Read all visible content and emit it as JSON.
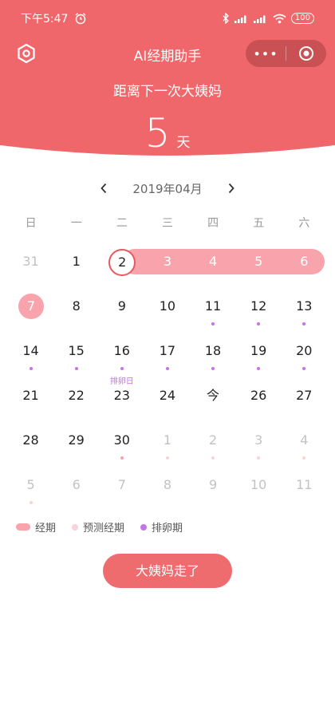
{
  "colors": {
    "header": "#f0676b",
    "accent": "#ee6b6e",
    "period": "#f9a3ad",
    "predicted": "#f8d3d7",
    "ovulation": "#c773e8"
  },
  "status_bar": {
    "time": "下午5:47",
    "alarm_icon": "alarm-icon",
    "battery": "100"
  },
  "app": {
    "title": "AI经期助手",
    "more": "•••"
  },
  "countdown": {
    "label": "距离下一次大姨妈",
    "days": "5",
    "unit": "天"
  },
  "calendar": {
    "month_label": "2019年04月",
    "prev_icon": "‹",
    "next_icon": "›",
    "weekdays": [
      "日",
      "一",
      "二",
      "三",
      "四",
      "五",
      "六"
    ],
    "weeks": [
      [
        {
          "d": "31",
          "o": true
        },
        {
          "d": "1"
        },
        {
          "d": "2",
          "sel": true
        },
        {
          "d": "3",
          "p": true
        },
        {
          "d": "4",
          "p": true
        },
        {
          "d": "5",
          "p": true
        },
        {
          "d": "6",
          "p": true
        }
      ],
      [
        {
          "d": "7",
          "tp": true
        },
        {
          "d": "8"
        },
        {
          "d": "9"
        },
        {
          "d": "10"
        },
        {
          "d": "11",
          "dot": "ov"
        },
        {
          "d": "12",
          "dot": "ov"
        },
        {
          "d": "13",
          "dot": "ov"
        }
      ],
      [
        {
          "d": "14",
          "dot": "ov"
        },
        {
          "d": "15",
          "dot": "ov"
        },
        {
          "d": "16",
          "dot": "ov",
          "tag": "排卵日"
        },
        {
          "d": "17",
          "dot": "ov"
        },
        {
          "d": "18",
          "dot": "ov"
        },
        {
          "d": "19",
          "dot": "ov"
        },
        {
          "d": "20",
          "dot": "ov"
        }
      ],
      [
        {
          "d": "21"
        },
        {
          "d": "22"
        },
        {
          "d": "23"
        },
        {
          "d": "24"
        },
        {
          "d": "今"
        },
        {
          "d": "26"
        },
        {
          "d": "27"
        }
      ],
      [
        {
          "d": "28"
        },
        {
          "d": "29"
        },
        {
          "d": "30",
          "dot": "pr"
        },
        {
          "d": "1",
          "o": true,
          "dot": "pr-light"
        },
        {
          "d": "2",
          "o": true,
          "dot": "pr-light"
        },
        {
          "d": "3",
          "o": true,
          "dot": "pr-light"
        },
        {
          "d": "4",
          "o": true,
          "dot": "pr-light"
        }
      ],
      [
        {
          "d": "5",
          "o": true,
          "dot": "pr-light"
        },
        {
          "d": "6",
          "o": true
        },
        {
          "d": "7",
          "o": true
        },
        {
          "d": "8",
          "o": true
        },
        {
          "d": "9",
          "o": true
        },
        {
          "d": "10",
          "o": true
        },
        {
          "d": "11",
          "o": true
        }
      ]
    ]
  },
  "legend": {
    "period": "经期",
    "predicted": "预测经期",
    "ovulation": "排卵期"
  },
  "action": {
    "label": "大姨妈走了"
  }
}
